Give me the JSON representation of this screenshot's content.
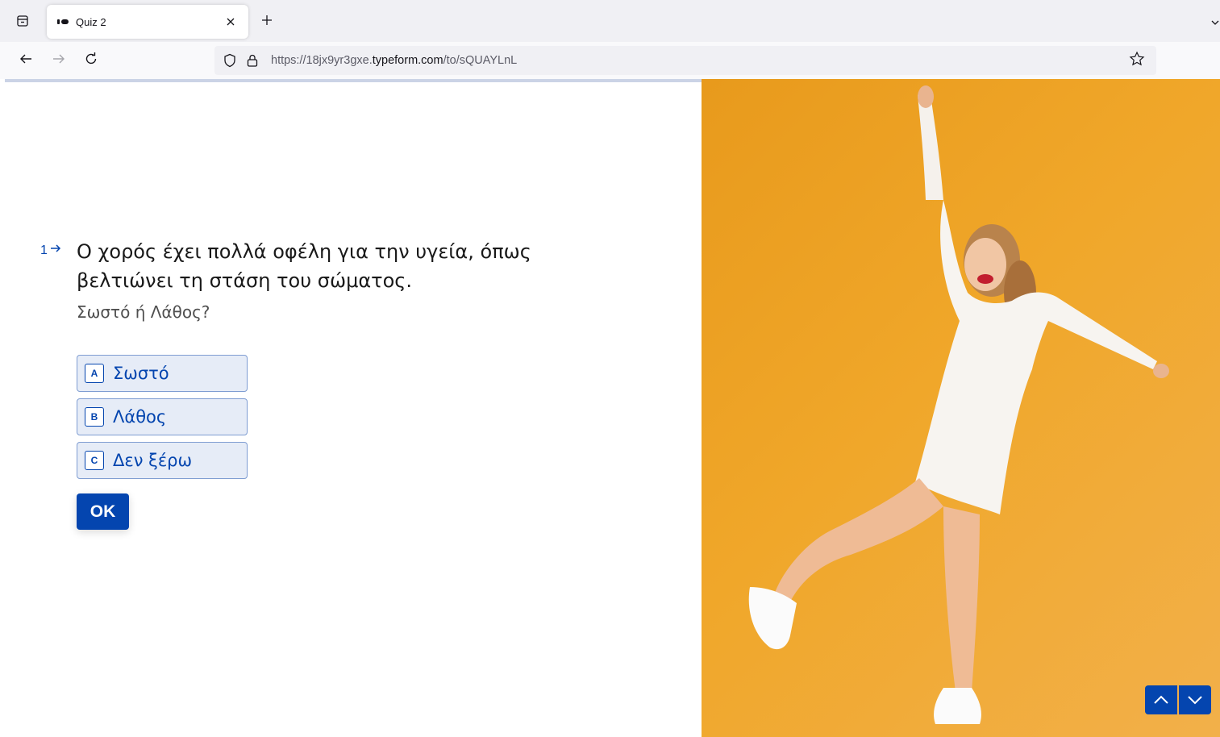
{
  "browser": {
    "tab": {
      "title": "Quiz 2",
      "favicon": "typeform-favicon"
    },
    "url": {
      "prefix": "https://18jx9yr3gxe.",
      "domain": "typeform.com",
      "path": "/to/sQUAYLnL"
    },
    "icons": [
      "tab-list-icon",
      "close-icon",
      "plus-icon",
      "back-arrow-icon",
      "forward-arrow-icon",
      "reload-icon",
      "tracking-shield-icon",
      "lock-icon",
      "star-icon"
    ]
  },
  "quiz": {
    "number": "1",
    "question": "Ο χορός έχει πολλά οφέλη για την υγεία, όπως βελτιώνει τη στάση του σώματος.",
    "subtitle": "Σωστό ή Λάθος?",
    "choices": [
      {
        "key": "A",
        "label": "Σωστό"
      },
      {
        "key": "B",
        "label": "Λάθος"
      },
      {
        "key": "C",
        "label": "Δεν ξέρω"
      }
    ],
    "ok_label": "OK"
  },
  "colors": {
    "accent": "#0445af",
    "choice_bg": "#e6ecf7",
    "photo_bg": "#f0a72a"
  },
  "image": {
    "subject": "woman-dancing-photo"
  },
  "navigation": {
    "icons": [
      "chevron-up-icon",
      "chevron-down-icon"
    ]
  }
}
